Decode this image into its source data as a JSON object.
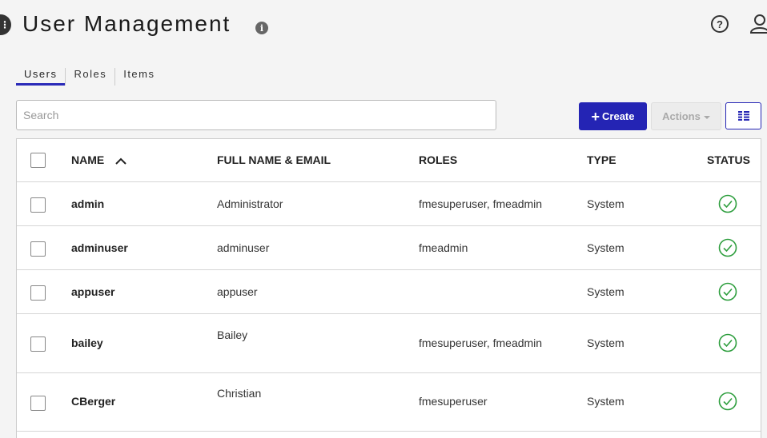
{
  "header": {
    "title": "User Management"
  },
  "tabs": [
    {
      "label": "Users",
      "active": true
    },
    {
      "label": "Roles",
      "active": false
    },
    {
      "label": "Items",
      "active": false
    }
  ],
  "search": {
    "placeholder": "Search",
    "value": ""
  },
  "toolbar": {
    "create_label": "Create",
    "actions_label": "Actions"
  },
  "table": {
    "columns": {
      "name": "NAME",
      "full_name_email": "FULL NAME & EMAIL",
      "roles": "ROLES",
      "type": "TYPE",
      "status": "STATUS"
    },
    "rows": [
      {
        "name": "admin",
        "full_name": "Administrator",
        "roles": "fmesuperuser, fmeadmin",
        "type": "System",
        "status": "active"
      },
      {
        "name": "adminuser",
        "full_name": "adminuser",
        "roles": "fmeadmin",
        "type": "System",
        "status": "active"
      },
      {
        "name": "appuser",
        "full_name": "appuser",
        "roles": "",
        "type": "System",
        "status": "active"
      },
      {
        "name": "bailey",
        "full_name": "Bailey",
        "roles": "fmesuperuser, fmeadmin",
        "type": "System",
        "status": "active"
      },
      {
        "name": "CBerger",
        "full_name": "Christian",
        "roles": "fmesuperuser",
        "type": "System",
        "status": "active"
      }
    ]
  },
  "colors": {
    "primary": "#2424b4",
    "status_ok": "#2e9e3e"
  }
}
